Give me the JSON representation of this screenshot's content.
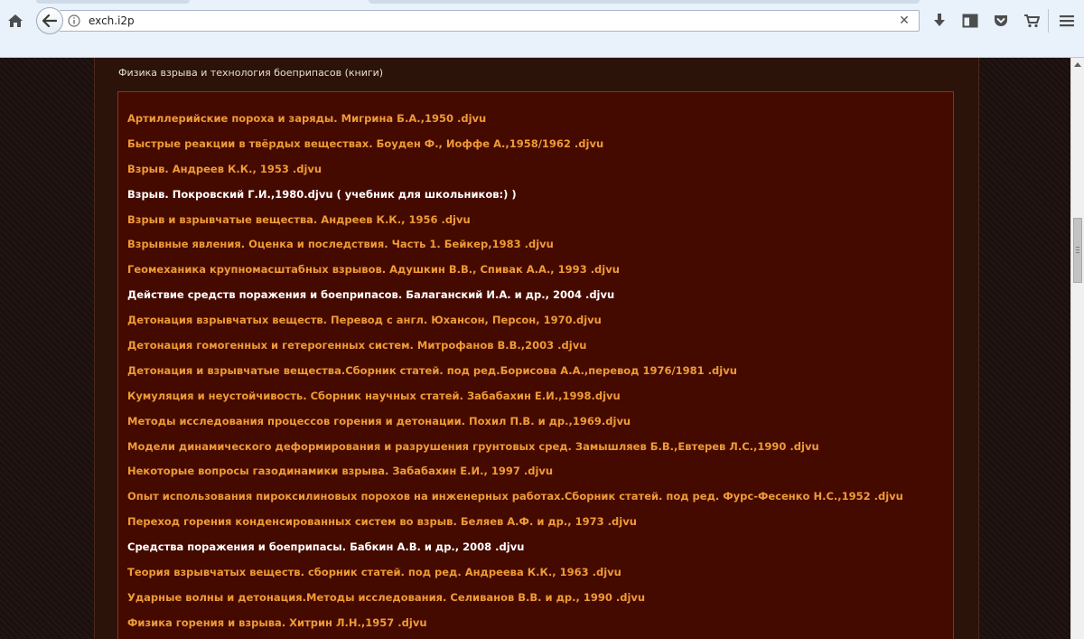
{
  "browser": {
    "url": "exch.i2p",
    "icons": {
      "home": "home-icon",
      "back": "back-arrow-icon",
      "info": "info-icon",
      "clear": "clear-icon",
      "downloads": "download-icon",
      "sidebar": "sidebar-icon",
      "pocket": "pocket-icon",
      "cart": "cart-icon",
      "menu": "hamburger-menu-icon"
    },
    "clear_glyph": "✕"
  },
  "colors": {
    "link_orange": "#ef9a36",
    "link_white": "#ffffff",
    "panel_bg": "#440a00",
    "page_bg": "#2c1309"
  },
  "section": {
    "title": "Физика взрыва и технология боеприпасов (книги)"
  },
  "books": [
    {
      "text": "Артиллерийские пороха и заряды. Мигрина Б.А.,1950 .djvu",
      "color": "orange"
    },
    {
      "text": "Быстрые реакции в твёрдых веществах. Боуден Ф., Иоффе А.,1958/1962 .djvu",
      "color": "orange"
    },
    {
      "text": "Взрыв. Андреев К.К., 1953 .djvu",
      "color": "orange"
    },
    {
      "text": "Взрыв. Покровский Г.И.,1980.djvu ( учебник для школьников:) )",
      "color": "white"
    },
    {
      "text": "Взрыв и взрывчатые вещества. Андреев К.К., 1956 .djvu",
      "color": "orange"
    },
    {
      "text": "Взрывные явления. Оценка и последствия. Часть 1. Бейкер,1983 .djvu",
      "color": "orange"
    },
    {
      "text": "Геомеханика крупномасштабных взрывов. Адушкин В.В., Спивак А.А., 1993 .djvu",
      "color": "orange"
    },
    {
      "text": "Действие средств поражения и боеприпасов. Балаганский И.А. и др., 2004 .djvu",
      "color": "white"
    },
    {
      "text": "Детонация взрывчатых веществ. Перевод с англ. Юхансон, Персон, 1970.djvu",
      "color": "orange"
    },
    {
      "text": "Детонация гомогенных и гетерогенных систем. Митрофанов В.В.,2003 .djvu",
      "color": "orange"
    },
    {
      "text": "Детонация и взрывчатые вещества.Сборник статей. под ред.Борисова А.А.,перевод 1976/1981 .djvu",
      "color": "orange"
    },
    {
      "text": "Кумуляция и неустойчивость. Сборник научных статей. Забабахин Е.И.,1998.djvu",
      "color": "orange"
    },
    {
      "text": "Методы исследования процессов горения и детонации. Похил П.В. и др.,1969.djvu",
      "color": "orange"
    },
    {
      "text": "Модели динамического деформирования и разрушения грунтовых сред. Замышляев Б.В.,Евтерев Л.С.,1990 .djvu",
      "color": "orange"
    },
    {
      "text": "Некоторые вопросы газодинамики взрыва. Забабахин Е.И., 1997 .djvu",
      "color": "orange"
    },
    {
      "text": "Опыт использования пироксилиновых порохов на инженерных работах.Сборник статей. под ред. Фурс-Фесенко Н.С.,1952 .djvu",
      "color": "orange"
    },
    {
      "text": "Переход горения конденсированных систем во взрыв. Беляев А.Ф. и др., 1973 .djvu",
      "color": "orange"
    },
    {
      "text": "Средства поражения и боеприпасы. Бабкин А.В. и др., 2008 .djvu",
      "color": "white"
    },
    {
      "text": "Теория взрывчатых веществ. сборник статей. под ред. Андреева К.К., 1963 .djvu",
      "color": "orange"
    },
    {
      "text": "Ударные волны и детонация.Методы исследования. Селиванов В.В. и др., 1990 .djvu",
      "color": "orange"
    },
    {
      "text": "Физика горения и взрыва. Хитрин Л.Н.,1957 .djvu",
      "color": "orange"
    }
  ]
}
